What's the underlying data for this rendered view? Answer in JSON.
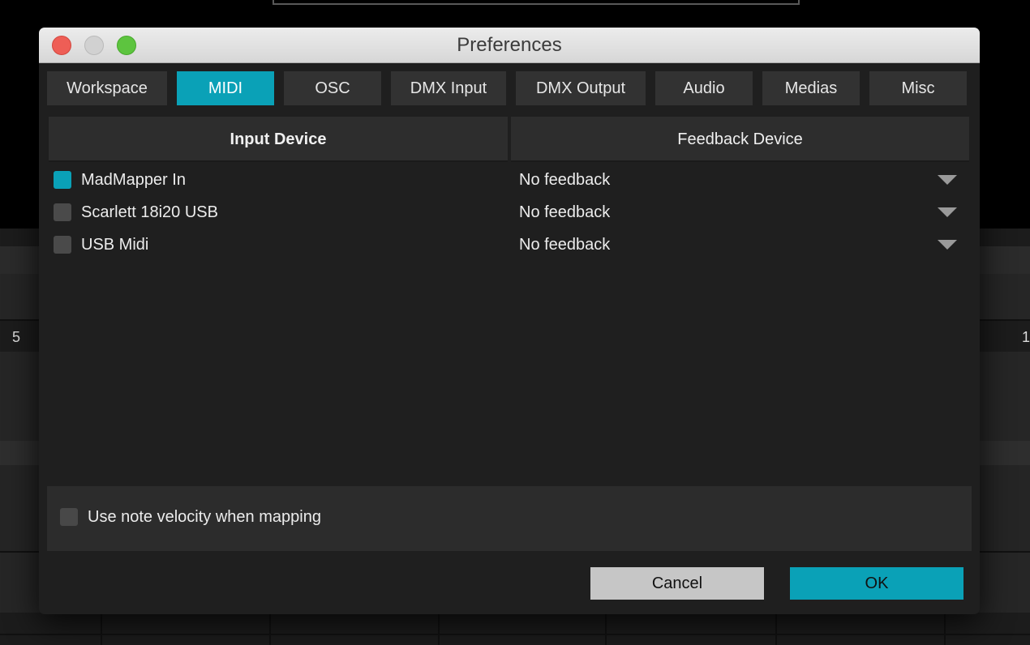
{
  "background": {
    "left_number": "5",
    "right_number": "1"
  },
  "window": {
    "title": "Preferences"
  },
  "tabs": [
    {
      "label": "Workspace",
      "active": false
    },
    {
      "label": "MIDI",
      "active": true
    },
    {
      "label": "OSC",
      "active": false
    },
    {
      "label": "DMX Input",
      "active": false
    },
    {
      "label": "DMX Output",
      "active": false
    },
    {
      "label": "Audio",
      "active": false
    },
    {
      "label": "Medias",
      "active": false
    },
    {
      "label": "Misc",
      "active": false
    }
  ],
  "table": {
    "headers": {
      "input_device": "Input Device",
      "feedback_device": "Feedback Device"
    },
    "rows": [
      {
        "device": "MadMapper In",
        "enabled": true,
        "feedback": "No feedback"
      },
      {
        "device": "Scarlett 18i20 USB",
        "enabled": false,
        "feedback": "No feedback"
      },
      {
        "device": "USB Midi",
        "enabled": false,
        "feedback": "No feedback"
      }
    ]
  },
  "options": {
    "note_velocity_label": "Use note velocity when mapping",
    "note_velocity_checked": false
  },
  "buttons": {
    "cancel": "Cancel",
    "ok": "OK"
  },
  "colors": {
    "accent": "#0aa1b7",
    "dialog_bg": "#1f1f1f",
    "tab_bg": "#323232",
    "cancel_bg": "#c6c6c6"
  }
}
